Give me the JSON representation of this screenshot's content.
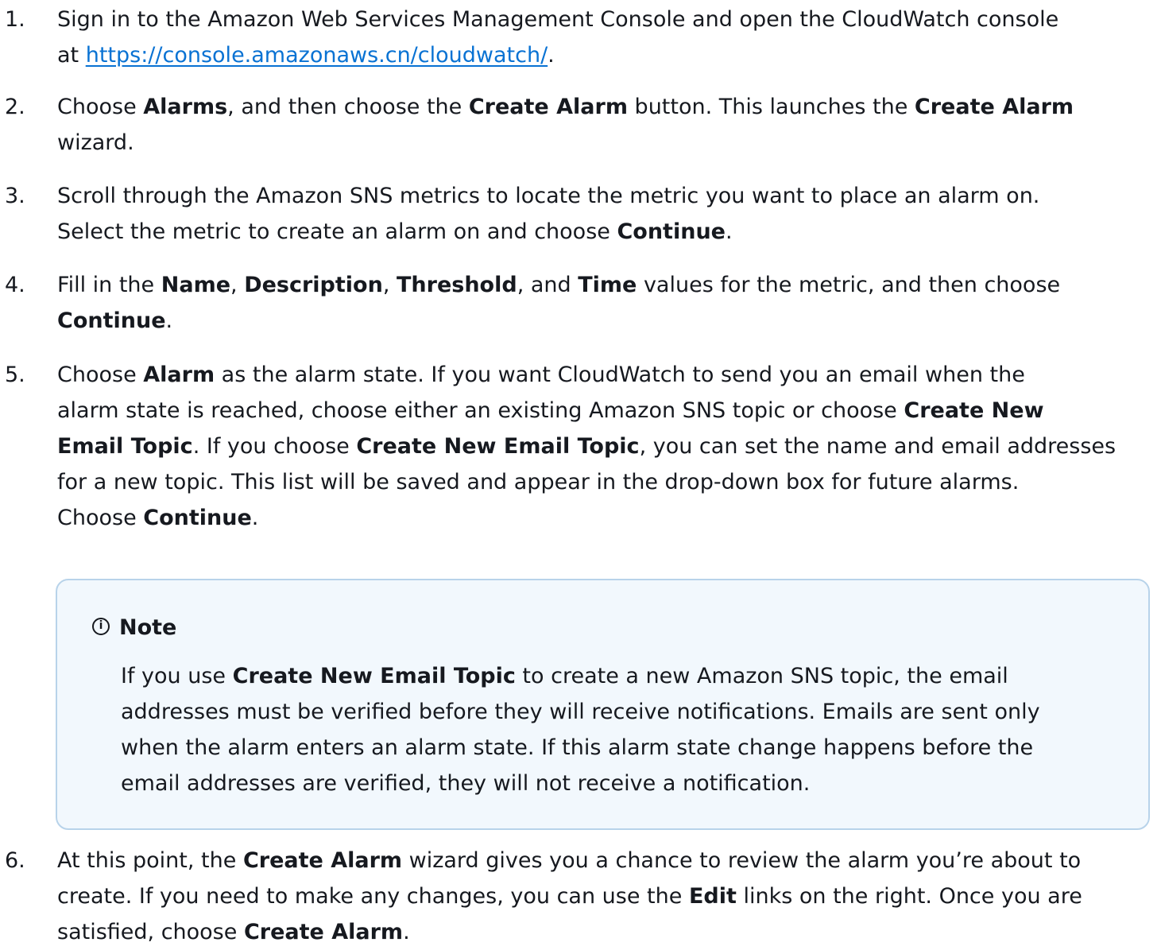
{
  "steps": [
    {
      "num": "1.",
      "lines": [
        [
          {
            "t": "Sign in to the Amazon Web Services Management Console and open the CloudWatch console"
          }
        ],
        [
          {
            "t": "at "
          },
          {
            "t": "https://console.amazonaws.cn/cloudwatch/",
            "link": true
          },
          {
            "t": "."
          }
        ]
      ]
    },
    {
      "num": "2.",
      "lines": [
        [
          {
            "t": "Choose "
          },
          {
            "t": "Alarms",
            "b": true
          },
          {
            "t": ", and then choose the "
          },
          {
            "t": "Create Alarm",
            "b": true
          },
          {
            "t": " button. This launches the "
          },
          {
            "t": "Create Alarm",
            "b": true
          }
        ],
        [
          {
            "t": "wizard."
          }
        ]
      ]
    },
    {
      "num": "3.",
      "lines": [
        [
          {
            "t": "Scroll through the Amazon SNS metrics to locate the metric you want to place an alarm on."
          }
        ],
        [
          {
            "t": "Select the metric to create an alarm on and choose "
          },
          {
            "t": "Continue",
            "b": true
          },
          {
            "t": "."
          }
        ]
      ]
    },
    {
      "num": "4.",
      "lines": [
        [
          {
            "t": "Fill in the "
          },
          {
            "t": "Name",
            "b": true
          },
          {
            "t": ", "
          },
          {
            "t": "Description",
            "b": true
          },
          {
            "t": ", "
          },
          {
            "t": "Threshold",
            "b": true
          },
          {
            "t": ", and "
          },
          {
            "t": "Time",
            "b": true
          },
          {
            "t": " values for the metric, and then choose"
          }
        ],
        [
          {
            "t": "Continue",
            "b": true
          },
          {
            "t": "."
          }
        ]
      ]
    },
    {
      "num": "5.",
      "lines": [
        [
          {
            "t": "Choose "
          },
          {
            "t": "Alarm",
            "b": true
          },
          {
            "t": " as the alarm state. If you want CloudWatch to send you an email when the"
          }
        ],
        [
          {
            "t": "alarm state is reached, choose either an existing Amazon SNS topic or choose "
          },
          {
            "t": "Create New",
            "b": true
          }
        ],
        [
          {
            "t": "Email Topic",
            "b": true
          },
          {
            "t": ". If you choose "
          },
          {
            "t": "Create New Email Topic",
            "b": true
          },
          {
            "t": ", you can set the name and email addresses"
          }
        ],
        [
          {
            "t": "for a new topic. This list will be saved and appear in the drop-down box for future alarms."
          }
        ],
        [
          {
            "t": "Choose "
          },
          {
            "t": "Continue",
            "b": true
          },
          {
            "t": "."
          }
        ]
      ]
    },
    {
      "num": "6.",
      "lines": [
        [
          {
            "t": "At this point, the "
          },
          {
            "t": "Create Alarm",
            "b": true
          },
          {
            "t": " wizard gives you a chance to review the alarm you’re about to"
          }
        ],
        [
          {
            "t": "create. If you need to make any changes, you can use the "
          },
          {
            "t": "Edit",
            "b": true
          },
          {
            "t": " links on the right. Once you are"
          }
        ],
        [
          {
            "t": "satisfied, choose "
          },
          {
            "t": "Create Alarm",
            "b": true
          },
          {
            "t": "."
          }
        ]
      ]
    }
  ],
  "note": {
    "icon": "info-icon",
    "icon_glyph": "i",
    "title": "Note",
    "lines": [
      [
        {
          "t": "If you use "
        },
        {
          "t": "Create New Email Topic",
          "b": true
        },
        {
          "t": " to create a new Amazon SNS topic, the email"
        }
      ],
      [
        {
          "t": "addresses must be verified before they will receive notifications. Emails are sent only"
        }
      ],
      [
        {
          "t": "when the alarm enters an alarm state. If this alarm state change happens before the"
        }
      ],
      [
        {
          "t": "email addresses are verified, they will not receive a notification."
        }
      ]
    ]
  },
  "colors": {
    "text": "#16191f",
    "link": "#0972d3",
    "note_background": "#f2f8fd",
    "note_border": "#b8d3ea"
  }
}
